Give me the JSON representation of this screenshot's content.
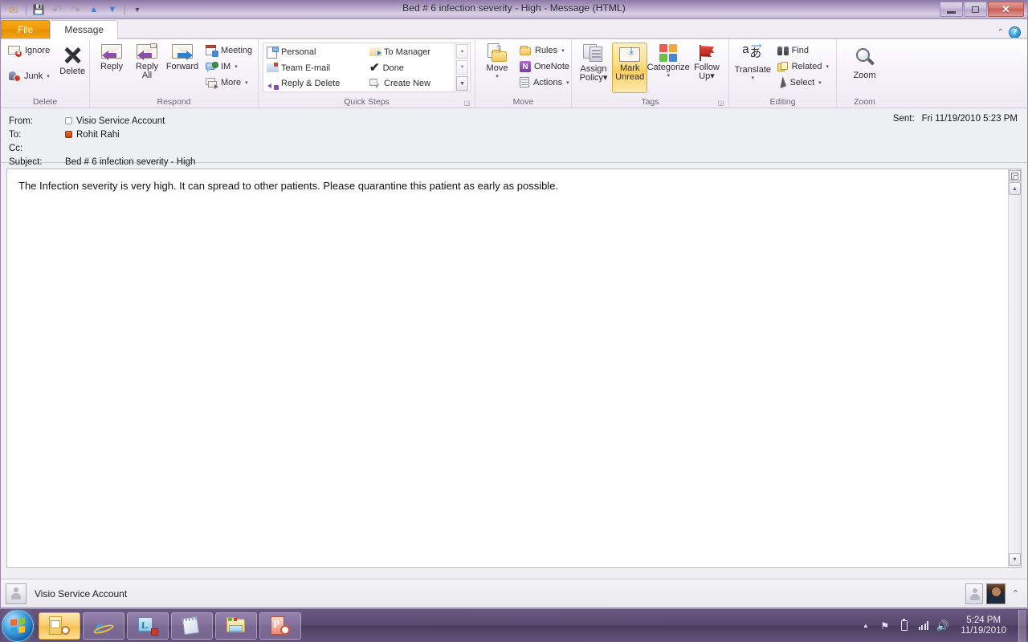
{
  "window": {
    "title": "Bed # 6 infection severity - High  -  Message (HTML)",
    "minimize_label": "–",
    "restore_label": "❐",
    "close_label": "✕"
  },
  "quick_access": {
    "items": [
      {
        "name": "outlook-icon",
        "glyph": "✉"
      },
      {
        "name": "save-icon",
        "glyph": "ὋE"
      },
      {
        "name": "undo-icon",
        "glyph": "↶"
      },
      {
        "name": "redo-icon",
        "glyph": "↷"
      },
      {
        "name": "previous-item-icon",
        "glyph": "▲"
      },
      {
        "name": "next-item-icon",
        "glyph": "▼"
      },
      {
        "name": "customize-qat-icon",
        "glyph": "▾"
      }
    ]
  },
  "tabs": {
    "file": "File",
    "message": "Message",
    "collapse_ribbon": "⌃",
    "help": "?"
  },
  "ribbon": {
    "groups": [
      {
        "name": "delete",
        "label": "Delete",
        "ignore": "Ignore",
        "junk": "Junk",
        "junk_arrow": "▾",
        "delete": "Delete"
      },
      {
        "name": "respond",
        "label": "Respond",
        "reply": "Reply",
        "reply_all_line1": "Reply",
        "reply_all_line2": "All",
        "forward": "Forward",
        "meeting": "Meeting",
        "im": "IM",
        "im_arrow": "▾",
        "more": "More",
        "more_arrow": "▾"
      },
      {
        "name": "quick-steps",
        "label": "Quick Steps",
        "personal": "Personal",
        "team_email": "Team E-mail",
        "reply_delete": "Reply & Delete",
        "to_manager": "To Manager",
        "done": "Done",
        "create_new": "Create New",
        "scroll_up": "▴",
        "scroll_down": "▾",
        "more_menu": "☰",
        "launcher": "◲"
      },
      {
        "name": "move",
        "label": "Move",
        "move": "Move",
        "move_arrow": "▾",
        "rules": "Rules",
        "rules_arrow": "▾",
        "onenote": "OneNote",
        "onenote_letter": "N",
        "actions": "Actions",
        "actions_arrow": "▾"
      },
      {
        "name": "tags",
        "label": "Tags",
        "assign_policy_line1": "Assign",
        "assign_policy_line2": "Policy",
        "assign_policy_arrow": "▾",
        "mark_unread_line1": "Mark",
        "mark_unread_line2": "Unread",
        "categorize": "Categorize",
        "categorize_arrow": "▾",
        "follow_up_line1": "Follow",
        "follow_up_line2": "Up",
        "follow_up_arrow": "▾",
        "launcher": "◲"
      },
      {
        "name": "editing",
        "label": "Editing",
        "translate": "Translate",
        "translate_arrow": "▾",
        "translate_glyph_a": "a",
        "translate_glyph_b": "あ",
        "find": "Find",
        "related": "Related",
        "related_arrow": "▾",
        "select": "Select",
        "select_arrow": "▾"
      },
      {
        "name": "zoom",
        "label": "Zoom",
        "zoom": "Zoom"
      }
    ]
  },
  "message": {
    "from_label": "From:",
    "from_value": "Visio Service Account",
    "to_label": "To:",
    "to_value": "Rohit Rahi",
    "cc_label": "Cc:",
    "cc_value": "",
    "subject_label": "Subject:",
    "subject_value": "Bed # 6 infection severity - High",
    "sent_label": "Sent:",
    "sent_value": "Fri 11/19/2010 5:23 PM",
    "body": "The Infection severity is very high. It can spread to other patients. Please quarantine this patient as early as possible."
  },
  "body_scrollbar": {
    "split_glyph": "⇱",
    "up_glyph": "▲",
    "down_glyph": "▼"
  },
  "people_pane": {
    "name": "Visio Service Account",
    "expand_glyph": "⌃"
  },
  "taskbar": {
    "start_label": "Start",
    "items": [
      {
        "name": "taskbar-outlook",
        "label": "Microsoft Outlook",
        "active": true
      },
      {
        "name": "taskbar-internet-explorer",
        "label": "Internet Explorer",
        "active": false
      },
      {
        "name": "taskbar-lync",
        "label": "Microsoft Lync",
        "active": false
      },
      {
        "name": "taskbar-notepad",
        "label": "Notepad",
        "active": false
      },
      {
        "name": "taskbar-explorer",
        "label": "Windows Explorer",
        "active": false
      },
      {
        "name": "taskbar-powerpoint",
        "label": "Microsoft PowerPoint",
        "active": false
      }
    ],
    "tray": {
      "show_hidden": "▲",
      "flag_glyph": "⚑",
      "battery_glyph": "▯",
      "network_label": "network",
      "volume_glyph": "ὐA",
      "time": "5:24 PM",
      "date": "11/19/2010"
    }
  },
  "colors": {
    "file_tab": "#f09a0a",
    "accent_purple": "#8a4fa8",
    "mark_unread_highlight": "#f8cf63",
    "busy_presence": "#c33d0c",
    "category_red": "#ee5a52",
    "category_orange": "#f0a93e",
    "category_green": "#6fbe4a",
    "category_blue": "#4a86d8"
  }
}
